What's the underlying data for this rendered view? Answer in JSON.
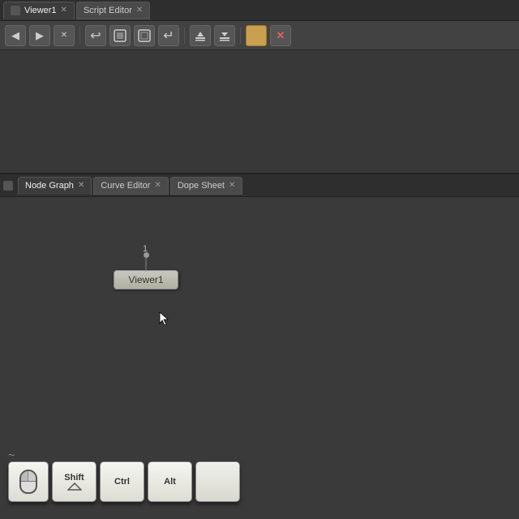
{
  "topPanel": {
    "tabs": [
      {
        "label": "Viewer1",
        "active": true,
        "hasIcon": true
      },
      {
        "label": "Script Editor",
        "active": false,
        "hasIcon": false
      }
    ],
    "toolbar": {
      "buttons": [
        {
          "icon": "◀",
          "name": "back"
        },
        {
          "icon": "▶",
          "name": "forward"
        },
        {
          "icon": "✕",
          "name": "close"
        },
        {
          "icon": "↩",
          "name": "undo"
        },
        {
          "icon": "◻",
          "name": "viewer"
        },
        {
          "icon": "◻",
          "name": "viewer2"
        },
        {
          "icon": "↵",
          "name": "enter"
        },
        {
          "icon": "⬇",
          "name": "down"
        },
        {
          "icon": "⬆",
          "name": "up"
        },
        {
          "icon": "⬛",
          "name": "color",
          "active": true
        },
        {
          "icon": "✕",
          "name": "x"
        }
      ]
    }
  },
  "bottomPanel": {
    "tabs": [
      {
        "label": "Node Graph",
        "active": true,
        "hasIcon": true
      },
      {
        "label": "Curve Editor",
        "active": false,
        "hasIcon": false
      },
      {
        "label": "Dope Sheet",
        "active": false,
        "hasIcon": false
      }
    ],
    "node": {
      "label": "Viewer1",
      "number": "1"
    }
  },
  "shortcuts": {
    "tilde": "~",
    "keys": [
      {
        "label": "Mouse",
        "sublabel": "",
        "isMouse": true
      },
      {
        "label": "Shift",
        "sublabel": ""
      },
      {
        "label": "Ctrl",
        "sublabel": ""
      },
      {
        "label": "Alt",
        "sublabel": ""
      },
      {
        "label": "",
        "sublabel": "",
        "isBlank": true
      }
    ]
  }
}
